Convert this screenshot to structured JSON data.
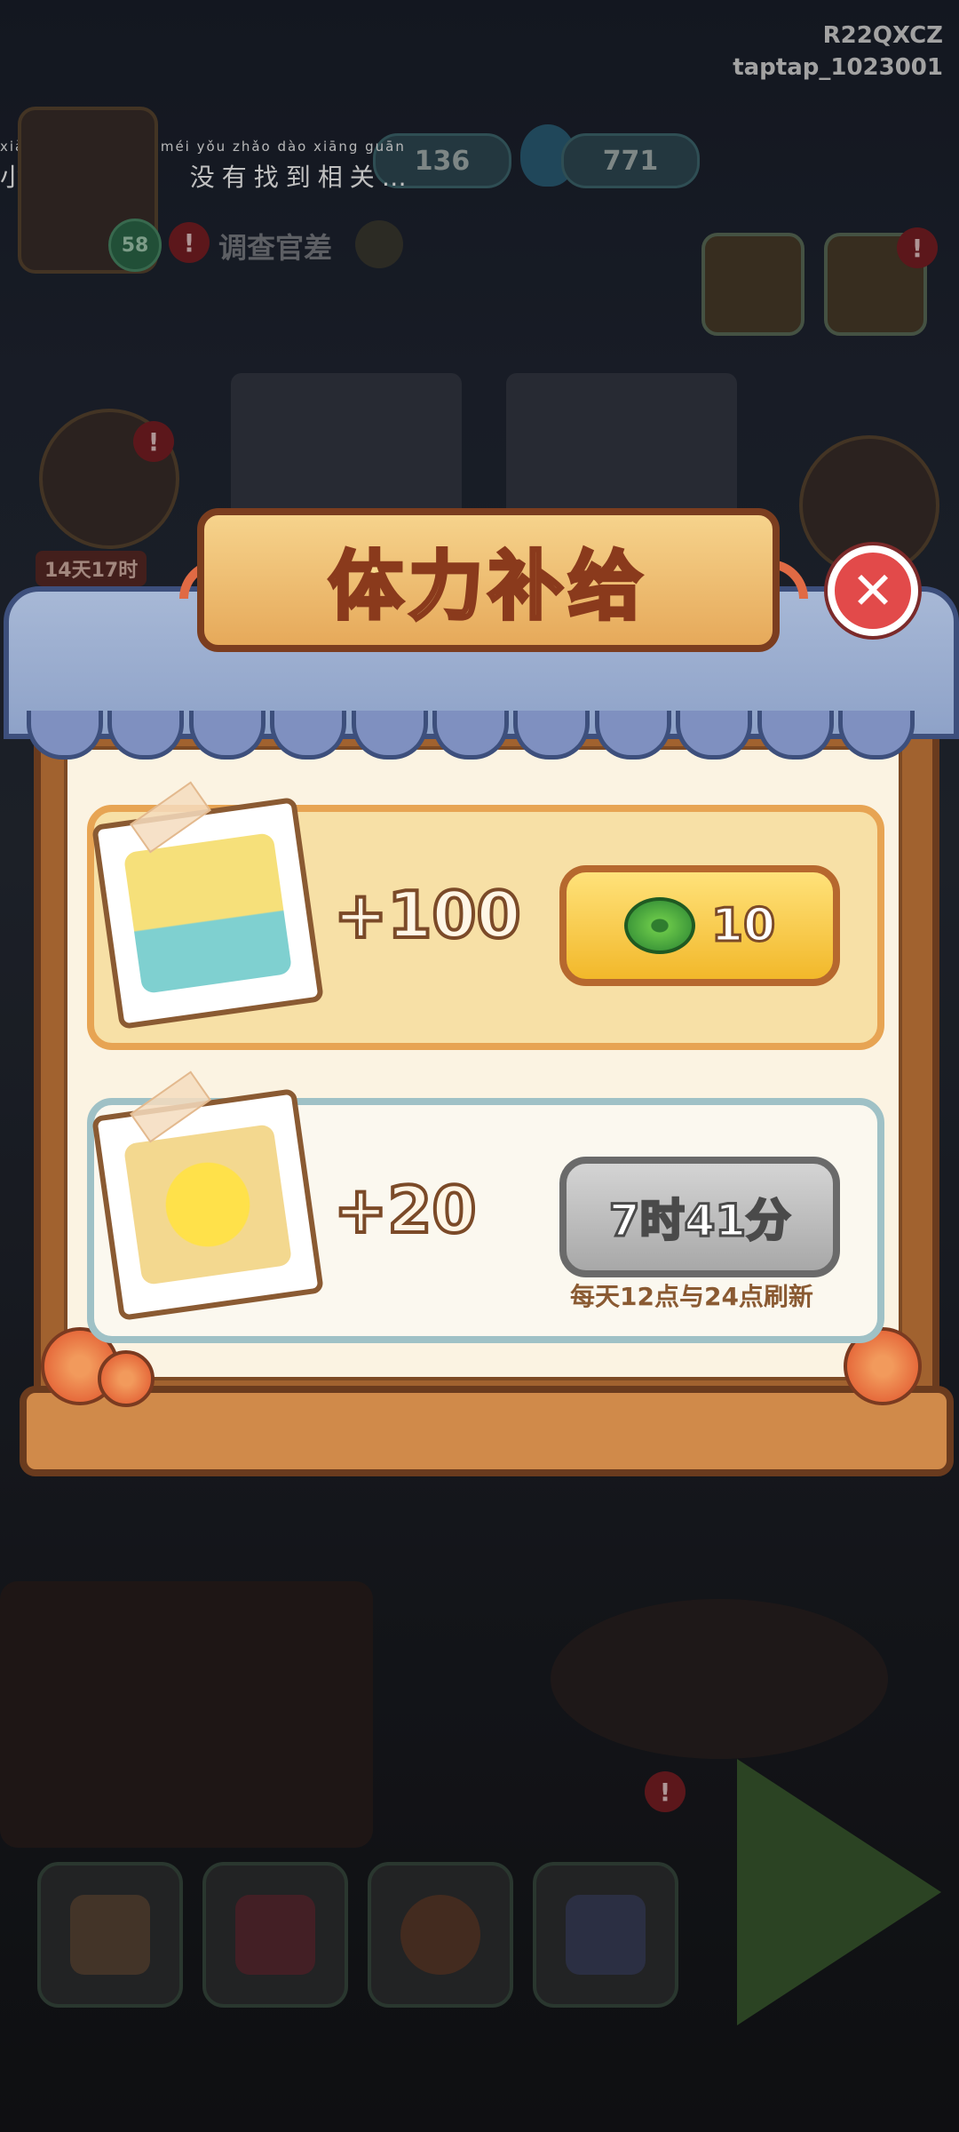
{
  "corner": {
    "line1": "R22QXCZ",
    "line2": "taptap_1023001"
  },
  "notification": {
    "pinyin": "xiǎo yíng bào qiàn   méi yǒu zhǎo dào xiāng guān",
    "text": "小萤·抱歉， 没有找到相关…"
  },
  "hud": {
    "coins": "136",
    "energy": "771",
    "level": "58",
    "investigator_label": "调查官差",
    "event_timer": "14天17时"
  },
  "modal": {
    "title": "体力补给",
    "close_icon": "close-x",
    "offers": [
      {
        "amount": "+100",
        "price": "10",
        "currency_icon": "green-coin"
      },
      {
        "amount": "+20",
        "cooldown": "7时41分",
        "note": "每天12点与24点刷新"
      }
    ]
  },
  "dock": [
    "home-icon",
    "book-icon",
    "pushpin-icon",
    "cards-icon",
    "play-board-icon"
  ],
  "colors": {
    "accent_orange": "#e7a453",
    "close_red": "#e24a4a",
    "title_brown": "#7b3d1f"
  }
}
